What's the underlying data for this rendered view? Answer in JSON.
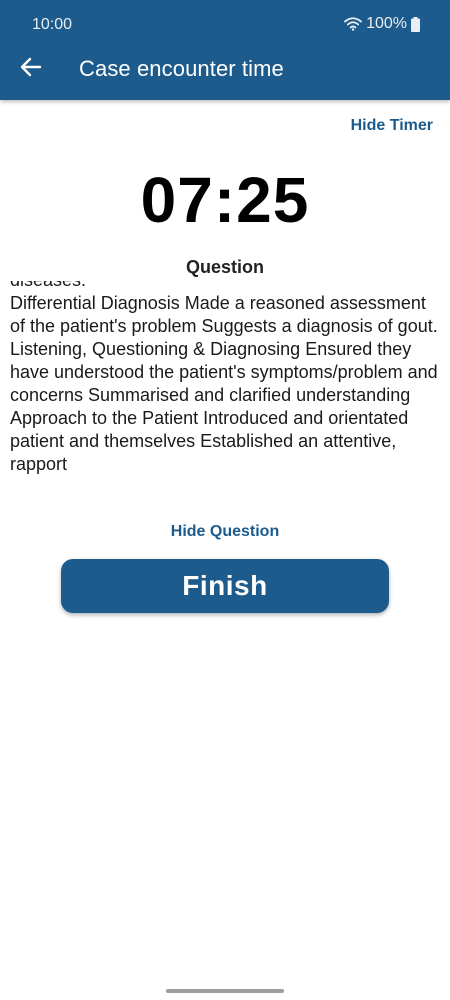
{
  "status_bar": {
    "time": "10:00",
    "battery_percent": "100%",
    "icons": [
      "wifi-icon",
      "battery-icon"
    ]
  },
  "app_bar": {
    "back_icon": "arrow-back-icon",
    "title": "Case encounter time"
  },
  "timer": {
    "toggle_label": "Hide Timer",
    "value": "07:25"
  },
  "question": {
    "heading": "Question",
    "lines": [
      "diseases.",
      "Differential Diagnosis Made a reasoned assessment of the patient's problem Suggests a diagnosis of gout.",
      "Listening, Questioning & Diagnosing Ensured they have understood the patient's symptoms/problem and concerns Summarised and clarified understanding",
      "Approach to the Patient Introduced and orientated patient and themselves Established an attentive, rapport"
    ],
    "toggle_label": "Hide Question"
  },
  "finish_button": {
    "label": "Finish"
  },
  "colors": {
    "primary": "#1d5b8c",
    "background": "#ffffff",
    "timer_text": "#000000"
  }
}
